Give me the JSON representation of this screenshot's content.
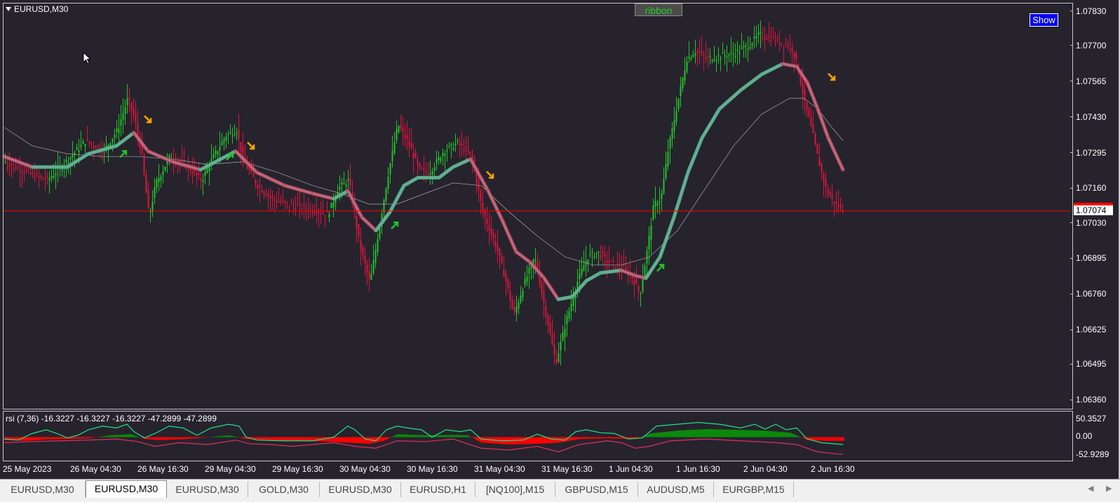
{
  "window": {
    "symbol_title": "EURUSD,M30",
    "ribbon_button": "ribbon",
    "show_button": "Show",
    "current_price": "1.07074",
    "colors": {
      "background": "#26232d",
      "bull": "#22c42a",
      "bear": "#dc143c",
      "ribbon_up": "#4fb08a",
      "ribbon_down": "#c04a64",
      "price_line": "#ff0000",
      "arrow_up": "#22c42a",
      "arrow_down": "#ffa500"
    }
  },
  "rsi_panel": {
    "label": "rsi  (7,36) -16.3227 -16.3227 -16.3227 -47.2899 -47.2899",
    "y_ticks": [
      "50.3527",
      "0.00",
      "-52.9289"
    ]
  },
  "price_axis": {
    "ticks": [
      "1.07830",
      "1.07700",
      "1.07565",
      "1.07430",
      "1.07295",
      "1.07160",
      "1.07030",
      "1.06895",
      "1.06760",
      "1.06625",
      "1.06495",
      "1.06360"
    ]
  },
  "time_axis": {
    "ticks": [
      "25 May 2023",
      "26 May 04:30",
      "26 May 16:30",
      "29 May 04:30",
      "29 May 16:30",
      "30 May 04:30",
      "30 May 16:30",
      "31 May 04:30",
      "31 May 16:30",
      "1 Jun 04:30",
      "1 Jun 16:30",
      "2 Jun 04:30",
      "2 Jun 16:30"
    ]
  },
  "tabs": [
    {
      "label": "EURUSD,M30",
      "active": false
    },
    {
      "label": "EURUSD,M30",
      "active": true
    },
    {
      "label": "EURUSD,M30",
      "active": false
    },
    {
      "label": "GOLD,M30",
      "active": false
    },
    {
      "label": "EURUSD,M30",
      "active": false
    },
    {
      "label": "EURUSD,H1",
      "active": false
    },
    {
      "label": "[NQ100],M15",
      "active": false
    },
    {
      "label": "GBPUSD,M15",
      "active": false
    },
    {
      "label": "AUDUSD,M5",
      "active": false
    },
    {
      "label": "EURGBP,M15",
      "active": false
    }
  ],
  "chart_data": {
    "type": "candlestick",
    "symbol": "EURUSD",
    "timeframe": "M30",
    "ylim": [
      1.0634,
      1.0785
    ],
    "path_points": [
      [
        0,
        1.0726
      ],
      [
        30,
        1.0722
      ],
      [
        60,
        1.0719
      ],
      [
        90,
        1.0727
      ],
      [
        115,
        1.0734
      ],
      [
        140,
        1.073
      ],
      [
        160,
        1.0738
      ],
      [
        175,
        1.075
      ],
      [
        185,
        1.0742
      ],
      [
        195,
        1.0728
      ],
      [
        205,
        1.0705
      ],
      [
        215,
        1.0718
      ],
      [
        235,
        1.0728
      ],
      [
        260,
        1.0724
      ],
      [
        280,
        1.0719
      ],
      [
        295,
        1.0727
      ],
      [
        315,
        1.0736
      ],
      [
        330,
        1.0738
      ],
      [
        340,
        1.0726
      ],
      [
        360,
        1.0717
      ],
      [
        380,
        1.0712
      ],
      [
        400,
        1.071
      ],
      [
        420,
        1.0709
      ],
      [
        440,
        1.0708
      ],
      [
        460,
        1.0706
      ],
      [
        475,
        1.0716
      ],
      [
        490,
        1.0719
      ],
      [
        505,
        1.0695
      ],
      [
        520,
        1.068
      ],
      [
        530,
        1.0696
      ],
      [
        545,
        1.072
      ],
      [
        560,
        1.074
      ],
      [
        575,
        1.0733
      ],
      [
        590,
        1.0723
      ],
      [
        605,
        1.0722
      ],
      [
        625,
        1.073
      ],
      [
        645,
        1.0733
      ],
      [
        665,
        1.0728
      ],
      [
        680,
        1.0708
      ],
      [
        700,
        1.0694
      ],
      [
        715,
        1.068
      ],
      [
        725,
        1.0668
      ],
      [
        740,
        1.068
      ],
      [
        755,
        1.069
      ],
      [
        770,
        1.067
      ],
      [
        785,
        1.065
      ],
      [
        800,
        1.0666
      ],
      [
        815,
        1.068
      ],
      [
        830,
        1.069
      ],
      [
        845,
        1.0692
      ],
      [
        860,
        1.0688
      ],
      [
        880,
        1.0686
      ],
      [
        895,
        1.0682
      ],
      [
        905,
        1.0676
      ],
      [
        915,
        1.0692
      ],
      [
        925,
        1.071
      ],
      [
        935,
        1.0712
      ],
      [
        945,
        1.073
      ],
      [
        960,
        1.075
      ],
      [
        972,
        1.0765
      ],
      [
        985,
        1.0768
      ],
      [
        1000,
        1.0765
      ],
      [
        1020,
        1.0766
      ],
      [
        1040,
        1.0767
      ],
      [
        1060,
        1.077
      ],
      [
        1075,
        1.0774
      ],
      [
        1090,
        1.0773
      ],
      [
        1105,
        1.0771
      ],
      [
        1120,
        1.077
      ],
      [
        1130,
        1.0762
      ],
      [
        1140,
        1.0748
      ],
      [
        1150,
        1.0738
      ],
      [
        1160,
        1.0726
      ],
      [
        1170,
        1.0716
      ],
      [
        1180,
        1.0711
      ],
      [
        1190,
        1.0709
      ],
      [
        1196,
        1.0707
      ]
    ],
    "ma_fast": [
      [
        0,
        1.0728
      ],
      [
        40,
        1.0724
      ],
      [
        90,
        1.0724
      ],
      [
        120,
        1.0729
      ],
      [
        160,
        1.0732
      ],
      [
        185,
        1.0737
      ],
      [
        205,
        1.073
      ],
      [
        240,
        1.0726
      ],
      [
        280,
        1.0723
      ],
      [
        330,
        1.073
      ],
      [
        360,
        1.0722
      ],
      [
        400,
        1.0717
      ],
      [
        440,
        1.0714
      ],
      [
        470,
        1.0712
      ],
      [
        490,
        1.0715
      ],
      [
        510,
        1.0705
      ],
      [
        530,
        1.07
      ],
      [
        550,
        1.0707
      ],
      [
        570,
        1.0717
      ],
      [
        590,
        1.072
      ],
      [
        620,
        1.072
      ],
      [
        640,
        1.0724
      ],
      [
        665,
        1.0727
      ],
      [
        690,
        1.0715
      ],
      [
        710,
        1.0704
      ],
      [
        730,
        1.0692
      ],
      [
        750,
        1.0688
      ],
      [
        770,
        1.0682
      ],
      [
        790,
        1.0674
      ],
      [
        810,
        1.0675
      ],
      [
        830,
        1.0681
      ],
      [
        850,
        1.0684
      ],
      [
        880,
        1.0685
      ],
      [
        900,
        1.0683
      ],
      [
        915,
        1.0682
      ],
      [
        935,
        1.069
      ],
      [
        955,
        1.0705
      ],
      [
        975,
        1.0722
      ],
      [
        995,
        1.0735
      ],
      [
        1020,
        1.0746
      ],
      [
        1050,
        1.0753
      ],
      [
        1080,
        1.0759
      ],
      [
        1110,
        1.0763
      ],
      [
        1130,
        1.0762
      ],
      [
        1145,
        1.0756
      ],
      [
        1160,
        1.0746
      ],
      [
        1175,
        1.0735
      ],
      [
        1196,
        1.0723
      ]
    ],
    "ma_slow": [
      [
        0,
        1.0739
      ],
      [
        40,
        1.0732
      ],
      [
        90,
        1.0729
      ],
      [
        140,
        1.0728
      ],
      [
        190,
        1.0728
      ],
      [
        240,
        1.0727
      ],
      [
        290,
        1.0725
      ],
      [
        340,
        1.0726
      ],
      [
        390,
        1.0722
      ],
      [
        440,
        1.0717
      ],
      [
        480,
        1.0714
      ],
      [
        520,
        1.071
      ],
      [
        560,
        1.071
      ],
      [
        600,
        1.0714
      ],
      [
        640,
        1.0718
      ],
      [
        680,
        1.0717
      ],
      [
        720,
        1.0707
      ],
      [
        760,
        1.0698
      ],
      [
        800,
        1.069
      ],
      [
        840,
        1.0687
      ],
      [
        880,
        1.0687
      ],
      [
        920,
        1.069
      ],
      [
        960,
        1.07
      ],
      [
        1000,
        1.0716
      ],
      [
        1040,
        1.0732
      ],
      [
        1080,
        1.0744
      ],
      [
        1120,
        1.075
      ],
      [
        1140,
        1.075
      ],
      [
        1160,
        1.0746
      ],
      [
        1180,
        1.0739
      ],
      [
        1196,
        1.0734
      ]
    ],
    "arrows_up": [
      [
        170,
        1.0729
      ],
      [
        322,
        1.0728
      ],
      [
        557,
        1.0702
      ],
      [
        936,
        1.0686
      ]
    ],
    "arrows_down": [
      [
        205,
        1.0742
      ],
      [
        352,
        1.0732
      ],
      [
        693,
        1.0721
      ],
      [
        1180,
        1.0758
      ]
    ],
    "current_price": 1.07074,
    "rsi": {
      "ylim": [
        -60,
        60
      ],
      "green_line": [
        [
          0,
          -5
        ],
        [
          20,
          -8
        ],
        [
          40,
          10
        ],
        [
          60,
          20
        ],
        [
          75,
          10
        ],
        [
          90,
          -2
        ],
        [
          105,
          5
        ],
        [
          120,
          20
        ],
        [
          140,
          30
        ],
        [
          160,
          25
        ],
        [
          175,
          35
        ],
        [
          185,
          15
        ],
        [
          200,
          -2
        ],
        [
          215,
          10
        ],
        [
          235,
          30
        ],
        [
          255,
          25
        ],
        [
          275,
          5
        ],
        [
          295,
          25
        ],
        [
          320,
          35
        ],
        [
          335,
          30
        ],
        [
          345,
          0
        ],
        [
          360,
          -8
        ],
        [
          400,
          -10
        ],
        [
          440,
          -10
        ],
        [
          470,
          0
        ],
        [
          490,
          30
        ],
        [
          500,
          20
        ],
        [
          515,
          -5
        ],
        [
          530,
          -10
        ],
        [
          545,
          20
        ],
        [
          560,
          30
        ],
        [
          575,
          25
        ],
        [
          595,
          20
        ],
        [
          610,
          0
        ],
        [
          630,
          20
        ],
        [
          650,
          15
        ],
        [
          665,
          20
        ],
        [
          680,
          -5
        ],
        [
          710,
          -10
        ],
        [
          740,
          -8
        ],
        [
          760,
          8
        ],
        [
          780,
          -5
        ],
        [
          800,
          -8
        ],
        [
          815,
          15
        ],
        [
          830,
          20
        ],
        [
          850,
          12
        ],
        [
          870,
          10
        ],
        [
          890,
          -5
        ],
        [
          910,
          -2
        ],
        [
          930,
          30
        ],
        [
          960,
          35
        ],
        [
          990,
          40
        ],
        [
          1020,
          35
        ],
        [
          1050,
          25
        ],
        [
          1070,
          35
        ],
        [
          1085,
          22
        ],
        [
          1100,
          35
        ],
        [
          1115,
          20
        ],
        [
          1130,
          25
        ],
        [
          1145,
          -5
        ],
        [
          1165,
          -15
        ],
        [
          1196,
          -20
        ]
      ],
      "red_line": [
        [
          0,
          -15
        ],
        [
          40,
          -12
        ],
        [
          80,
          -10
        ],
        [
          120,
          -8
        ],
        [
          160,
          -5
        ],
        [
          190,
          -12
        ],
        [
          215,
          -25
        ],
        [
          250,
          -15
        ],
        [
          290,
          -20
        ],
        [
          330,
          -8
        ],
        [
          350,
          -18
        ],
        [
          380,
          -20
        ],
        [
          410,
          -25
        ],
        [
          440,
          -20
        ],
        [
          470,
          -15
        ],
        [
          500,
          -25
        ],
        [
          530,
          -30
        ],
        [
          560,
          -10
        ],
        [
          600,
          -12
        ],
        [
          640,
          -5
        ],
        [
          680,
          -30
        ],
        [
          720,
          -35
        ],
        [
          760,
          -25
        ],
        [
          790,
          -40
        ],
        [
          820,
          -20
        ],
        [
          860,
          -10
        ],
        [
          880,
          -15
        ],
        [
          900,
          -30
        ],
        [
          920,
          -25
        ],
        [
          950,
          -10
        ],
        [
          1000,
          -5
        ],
        [
          1050,
          -10
        ],
        [
          1100,
          -15
        ],
        [
          1130,
          -20
        ],
        [
          1160,
          -40
        ],
        [
          1196,
          -47
        ]
      ],
      "histogram": [
        [
          0,
          -8
        ],
        [
          30,
          -10
        ],
        [
          60,
          -6
        ],
        [
          90,
          -5
        ],
        [
          120,
          -3
        ],
        [
          150,
          5
        ],
        [
          180,
          8
        ],
        [
          200,
          -5
        ],
        [
          220,
          -8
        ],
        [
          260,
          -5
        ],
        [
          290,
          0
        ],
        [
          320,
          5
        ],
        [
          345,
          -5
        ],
        [
          380,
          -8
        ],
        [
          420,
          -10
        ],
        [
          460,
          -12
        ],
        [
          490,
          -15
        ],
        [
          520,
          -18
        ],
        [
          540,
          -10
        ],
        [
          560,
          8
        ],
        [
          600,
          5
        ],
        [
          640,
          6
        ],
        [
          660,
          5
        ],
        [
          680,
          -15
        ],
        [
          720,
          -20
        ],
        [
          760,
          -18
        ],
        [
          790,
          -15
        ],
        [
          820,
          -5
        ],
        [
          860,
          -3
        ],
        [
          900,
          -5
        ],
        [
          920,
          10
        ],
        [
          960,
          18
        ],
        [
          1000,
          22
        ],
        [
          1040,
          20
        ],
        [
          1080,
          18
        ],
        [
          1120,
          12
        ],
        [
          1145,
          -8
        ],
        [
          1170,
          -10
        ],
        [
          1196,
          -10
        ]
      ]
    }
  }
}
